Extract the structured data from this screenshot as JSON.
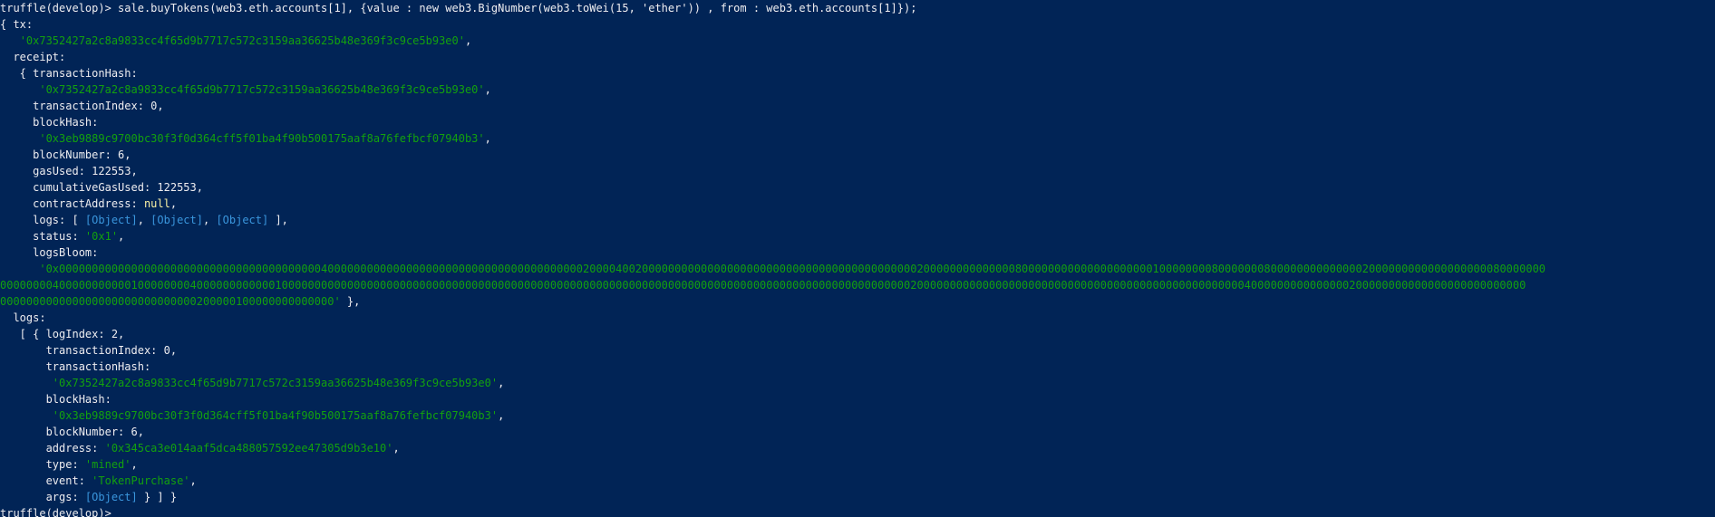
{
  "colors": {
    "background": "#012456",
    "text": "#eeedf0",
    "string": "#13a10e",
    "object_ref": "#3a96dd",
    "null_value": "#f9f1a5"
  },
  "lines": [
    [
      {
        "t": "truffle(develop)> sale.buyTokens(web3.eth.accounts[1], {value : new web3.BigNumber(web3.toWei(15, 'ether')) , from : web3.eth.accounts[1]});",
        "c": "plain"
      }
    ],
    [
      {
        "t": "{ tx:",
        "c": "plain"
      }
    ],
    [
      {
        "t": "   ",
        "c": "plain"
      },
      {
        "t": "'0x7352427a2c8a9833cc4f65d9b7717c572c3159aa36625b48e369f3c9ce5b93e0'",
        "c": "str"
      },
      {
        "t": ",",
        "c": "plain"
      }
    ],
    [
      {
        "t": "  receipt:",
        "c": "plain"
      }
    ],
    [
      {
        "t": "   { transactionHash:",
        "c": "plain"
      }
    ],
    [
      {
        "t": "      ",
        "c": "plain"
      },
      {
        "t": "'0x7352427a2c8a9833cc4f65d9b7717c572c3159aa36625b48e369f3c9ce5b93e0'",
        "c": "str"
      },
      {
        "t": ",",
        "c": "plain"
      }
    ],
    [
      {
        "t": "     transactionIndex: 0,",
        "c": "plain"
      }
    ],
    [
      {
        "t": "     blockHash:",
        "c": "plain"
      }
    ],
    [
      {
        "t": "      ",
        "c": "plain"
      },
      {
        "t": "'0x3eb9889c9700bc30f3f0d364cff5f01ba4f90b500175aaf8a76fefbcf07940b3'",
        "c": "str"
      },
      {
        "t": ",",
        "c": "plain"
      }
    ],
    [
      {
        "t": "     blockNumber: 6,",
        "c": "plain"
      }
    ],
    [
      {
        "t": "     gasUsed: 122553,",
        "c": "plain"
      }
    ],
    [
      {
        "t": "     cumulativeGasUsed: 122553,",
        "c": "plain"
      }
    ],
    [
      {
        "t": "     contractAddress: ",
        "c": "plain"
      },
      {
        "t": "null",
        "c": "null"
      },
      {
        "t": ",",
        "c": "plain"
      }
    ],
    [
      {
        "t": "     logs: [ ",
        "c": "plain"
      },
      {
        "t": "[Object]",
        "c": "obj"
      },
      {
        "t": ", ",
        "c": "plain"
      },
      {
        "t": "[Object]",
        "c": "obj"
      },
      {
        "t": ", ",
        "c": "plain"
      },
      {
        "t": "[Object]",
        "c": "obj"
      },
      {
        "t": " ],",
        "c": "plain"
      }
    ],
    [
      {
        "t": "     status: ",
        "c": "plain"
      },
      {
        "t": "'0x1'",
        "c": "str"
      },
      {
        "t": ",",
        "c": "plain"
      }
    ],
    [
      {
        "t": "     logsBloom:",
        "c": "plain"
      }
    ],
    [
      {
        "t": "      ",
        "c": "plain"
      },
      {
        "t": "'0x00000000000000000000000000000000000000004000000000000000000000000000000000000000200004002000000000000000000000000000000000000000000200000000000000800000000000000000000100000000800000008000000000000002000000000000000000080000000",
        "c": "str"
      }
    ],
    [
      {
        "t": "00000000400000000000100000000400000000000010000000000000000000000000000000000000000000000000000000000000000000000000000000000000000000000002000000000000000000000000000000000000000000000000004000000000000000200000000000000000000000000",
        "c": "str"
      }
    ],
    [
      {
        "t": "000000000000000000000000000000200000100000000000000'",
        "c": "str"
      },
      {
        "t": " },",
        "c": "plain"
      }
    ],
    [
      {
        "t": "  logs:",
        "c": "plain"
      }
    ],
    [
      {
        "t": "   [ { logIndex: 2,",
        "c": "plain"
      }
    ],
    [
      {
        "t": "       transactionIndex: 0,",
        "c": "plain"
      }
    ],
    [
      {
        "t": "       transactionHash:",
        "c": "plain"
      }
    ],
    [
      {
        "t": "        ",
        "c": "plain"
      },
      {
        "t": "'0x7352427a2c8a9833cc4f65d9b7717c572c3159aa36625b48e369f3c9ce5b93e0'",
        "c": "str"
      },
      {
        "t": ",",
        "c": "plain"
      }
    ],
    [
      {
        "t": "       blockHash:",
        "c": "plain"
      }
    ],
    [
      {
        "t": "        ",
        "c": "plain"
      },
      {
        "t": "'0x3eb9889c9700bc30f3f0d364cff5f01ba4f90b500175aaf8a76fefbcf07940b3'",
        "c": "str"
      },
      {
        "t": ",",
        "c": "plain"
      }
    ],
    [
      {
        "t": "       blockNumber: 6,",
        "c": "plain"
      }
    ],
    [
      {
        "t": "       address: ",
        "c": "plain"
      },
      {
        "t": "'0x345ca3e014aaf5dca488057592ee47305d9b3e10'",
        "c": "str"
      },
      {
        "t": ",",
        "c": "plain"
      }
    ],
    [
      {
        "t": "       type: ",
        "c": "plain"
      },
      {
        "t": "'mined'",
        "c": "str"
      },
      {
        "t": ",",
        "c": "plain"
      }
    ],
    [
      {
        "t": "       event: ",
        "c": "plain"
      },
      {
        "t": "'TokenPurchase'",
        "c": "str"
      },
      {
        "t": ",",
        "c": "plain"
      }
    ],
    [
      {
        "t": "       args: ",
        "c": "plain"
      },
      {
        "t": "[Object]",
        "c": "obj"
      },
      {
        "t": " } ] }",
        "c": "plain"
      }
    ],
    [
      {
        "t": "truffle(develop)> ",
        "c": "plain"
      }
    ]
  ]
}
